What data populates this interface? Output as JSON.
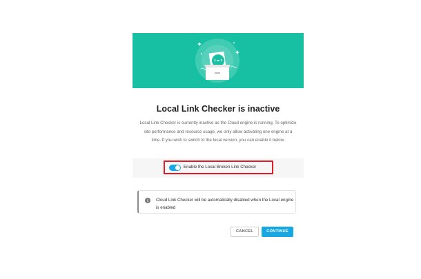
{
  "modal": {
    "hero_icon": "drawer-with-link-illustration",
    "title": "Local Link Checker is inactive",
    "description": "Local Link Checker is currently inactive as the Cloud engine is running. To optimize site performance and resource usage, we only allow activating one engine at a time. If you wish to switch to the local version, you can enable it below.",
    "toggle": {
      "label": "Enable the Local Broken Link Checker",
      "state": "on"
    },
    "notice": {
      "icon": "info-icon",
      "text": "Cloud Link Checker will be automatically disabled when the Local engine is enabled"
    },
    "buttons": {
      "cancel_label": "CANCEL",
      "continue_label": "CONTINUE"
    }
  },
  "colors": {
    "hero_bg": "#17c0a3",
    "accent": "#17a8e3",
    "highlight_border": "#e01a26"
  }
}
